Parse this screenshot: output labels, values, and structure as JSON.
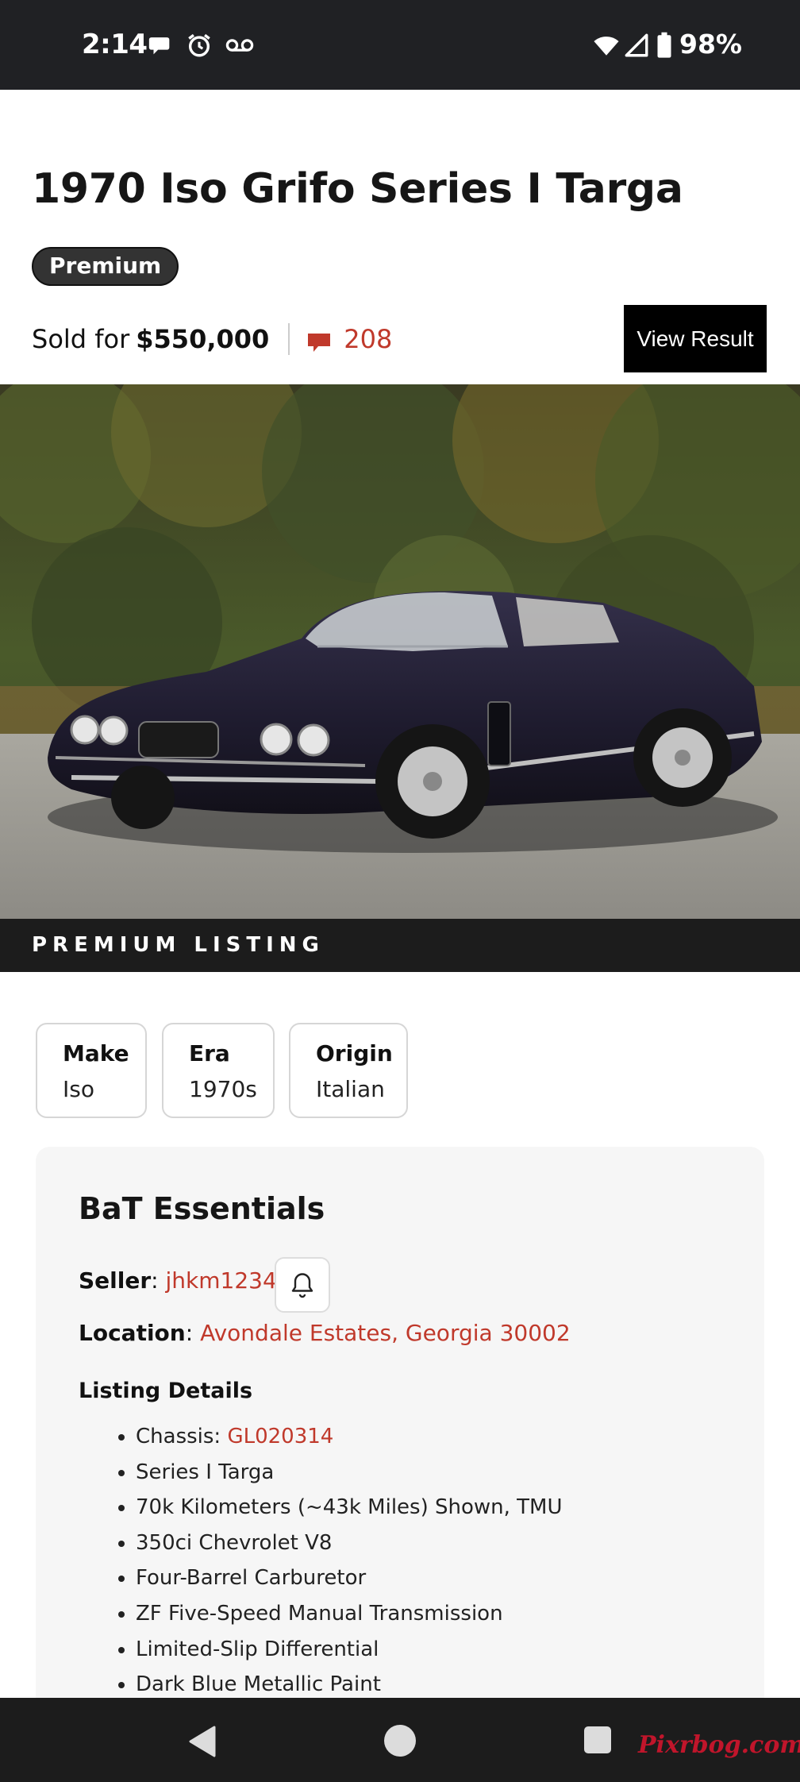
{
  "status_bar": {
    "time": "2:14",
    "battery": "98%",
    "icons": [
      "chat-bubble-icon",
      "alarm-icon",
      "voicemail-icon",
      "wifi-icon",
      "signal-icon",
      "battery-icon"
    ]
  },
  "listing": {
    "title": "1970 Iso Grifo Series I Targa",
    "badge": "Premium",
    "sold_label": "Sold for",
    "sold_price": "$550,000",
    "comment_count": "208",
    "view_result_label": "View Result",
    "premium_strip": "PREMIUM LISTING"
  },
  "tags": [
    {
      "label": "Make",
      "value": "Iso"
    },
    {
      "label": "Era",
      "value": "1970s"
    },
    {
      "label": "Origin",
      "value": "Italian"
    }
  ],
  "essentials": {
    "title": "BaT Essentials",
    "seller_label": "Seller",
    "seller_value": "jhkm12345",
    "location_label": "Location",
    "location_value": "Avondale Estates, Georgia 30002",
    "listing_details_title": "Listing Details",
    "chassis_label": "Chassis: ",
    "chassis_value": "GL020314",
    "details": [
      "Series I Targa",
      "70k Kilometers (~43k Miles) Shown, TMU",
      "350ci Chevrolet V8",
      "Four-Barrel Carburetor",
      "ZF Five-Speed Manual Transmission",
      "Limited-Slip Differential",
      "Dark Blue Metallic Paint"
    ]
  },
  "watermark": "Pixrbog.com",
  "colors": {
    "link": "#c0392b",
    "status_bar": "#202124",
    "button": "#000000",
    "badge": "#333333"
  }
}
